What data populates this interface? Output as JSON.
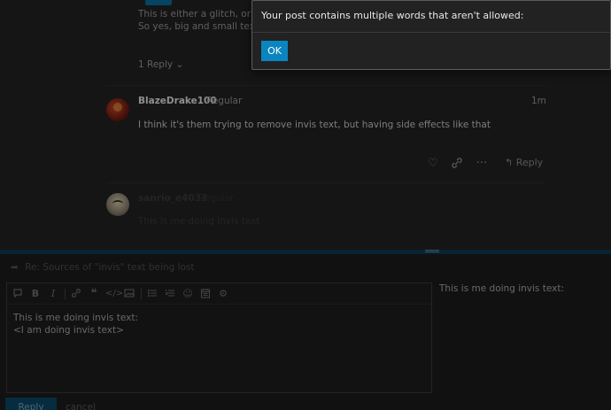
{
  "topic": {
    "post_partial": {
      "line1": "This is either a glitch, or the",
      "line2": "So yes, big and small text ar",
      "replies_label": "1 Reply",
      "replies_chevron": "⌄"
    },
    "post_blaze": {
      "username": "BlazeDrake100",
      "role": "Regular",
      "time": "1m",
      "body": "I think it's them trying to remove invis text, but having side effects like that",
      "reply_label": "Reply",
      "actions": [
        "heart-icon",
        "link-icon",
        "more-icon",
        "reply-icon"
      ]
    },
    "post_draft": {
      "username": "sanrio_e4033",
      "role": "Regular",
      "body": "This is me doing invis text"
    }
  },
  "composer": {
    "reply_to": "Re: Sources of \"invis\" text being lost",
    "toolbar": [
      "quote-icon",
      "bold-icon",
      "italic-icon",
      "link-icon",
      "blockquote-icon",
      "code-icon",
      "image-icon",
      "bullet-list-icon",
      "numbered-list-icon",
      "emoji-icon",
      "date-icon",
      "settings-icon"
    ],
    "editor_lines": [
      "This is me doing invis text:",
      "<I am doing invis text>"
    ],
    "preview": "This is me doing invis text:",
    "submit_label": "Reply",
    "cancel_label": "cancel"
  },
  "modal": {
    "message": "Your post contains multiple words that aren't allowed:",
    "ok_label": "OK"
  },
  "colors": {
    "accent": "#0a85bf",
    "background": "#222222"
  }
}
